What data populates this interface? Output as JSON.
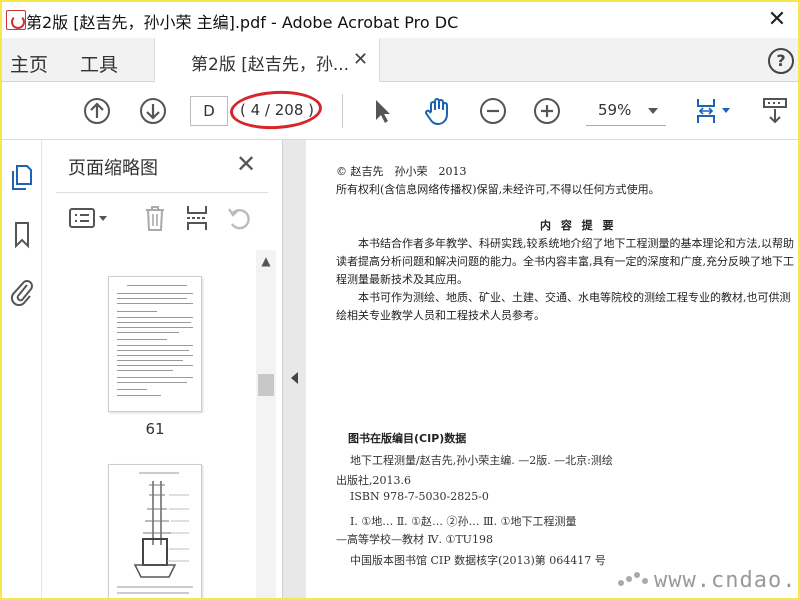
{
  "window": {
    "title": "第2版 [赵吉先，孙小荣 主编].pdf - Adobe Acrobat Pro DC",
    "close_glyph": "✕"
  },
  "tabs": {
    "home_label": "主页",
    "tools_label": "工具",
    "doc_tab_label": "第2版 [赵吉先，孙...",
    "doc_tab_close": "✕",
    "help_glyph": "?"
  },
  "toolbar": {
    "page_input_value": "D",
    "page_count": "( 4 / 208 )",
    "zoom_value": "59%",
    "highlight_color": "#d6262b"
  },
  "icons": {
    "prev_page": "arrow-up-circle-icon",
    "next_page": "arrow-down-circle-icon",
    "select": "cursor-arrow-icon",
    "hand": "hand-icon",
    "zoom_out": "minus-circle-icon",
    "zoom_in": "plus-circle-icon",
    "fit": "fit-page-icon",
    "scroll_mode": "scroll-mode-icon"
  },
  "accent_color": "#1c63b5",
  "sidebar": {
    "panel_title": "页面缩略图",
    "panel_close": "✕"
  },
  "thumbnails": [
    {
      "label": "61"
    },
    {
      "label": ""
    }
  ],
  "document": {
    "copyright": "© 赵吉先　孙小荣　2013",
    "rights": "所有权利(含信息网络传播权)保留,未经许可,不得以任何方式使用。",
    "summary_title": "内 容 提 要",
    "para1": "　　本书结合作者多年教学、科研实践,较系统地介绍了地下工程测量的基本理论和方法,以帮助读者提高分析问题和解决问题的能力。全书内容丰富,具有一定的深度和广度,充分反映了地下工程测量最新技术及其应用。",
    "para2": "　　本书可作为测绘、地质、矿业、土建、交通、水电等院校的测绘工程专业的教材,也可供测绘相关专业教学人员和工程技术人员参考。",
    "cip_title": "图书在版编目(CIP)数据",
    "cip_lines": [
      "地下工程测量/赵吉先,孙小荣主编. —2版. —北京:测绘",
      "出版社,2013.6",
      "ISBN 978-7-5030-2825-0",
      "Ⅰ. ①地… Ⅱ. ①赵… ②孙… Ⅲ. ①地下工程测量",
      "—高等学校—教材 Ⅳ. ①TU198",
      "中国版本图书馆 CIP 数据核字(2013)第 064417 号"
    ],
    "watermark": "www.cndao.com"
  }
}
